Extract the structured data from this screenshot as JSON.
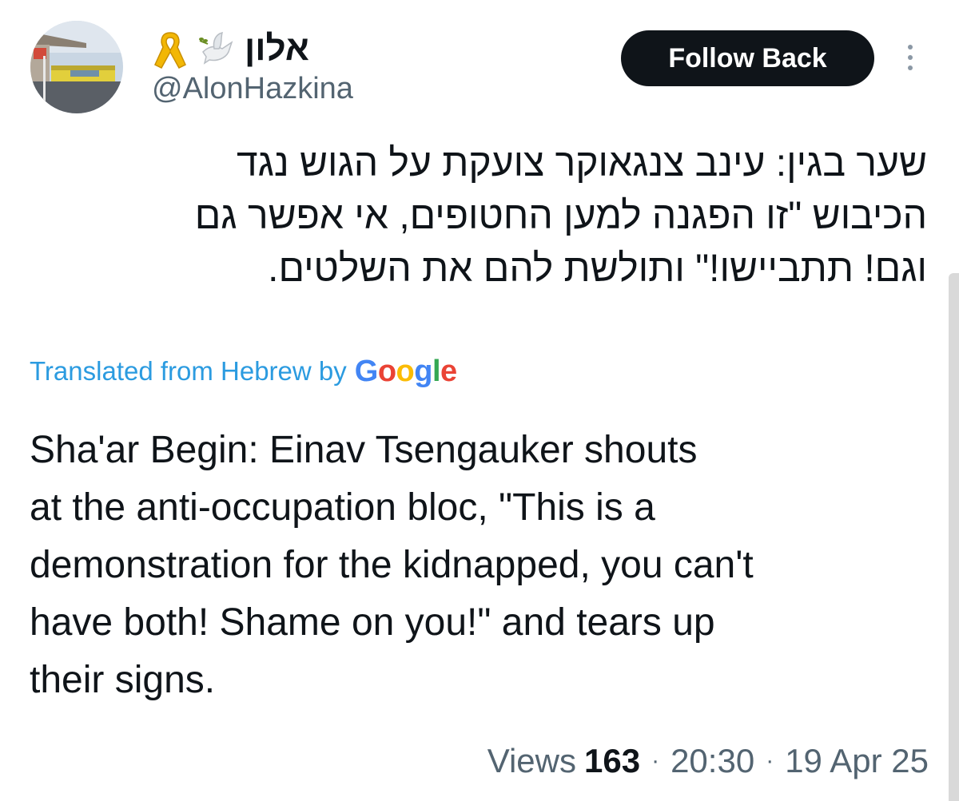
{
  "author": {
    "display_name": "אלון",
    "handle": "@AlonHazkina",
    "badges": [
      "yellow-ribbon-icon",
      "dove-icon"
    ]
  },
  "actions": {
    "follow_label": "Follow Back",
    "more_icon": "more-vertical-icon"
  },
  "tweet": {
    "original_text_lines": [
      "שער בגין: עינב צנגאוקר צועקת על הגוש נגד",
      "הכיבוש \"זו הפגנה למען החטופים, אי אפשר גם",
      "וגם! תתביישו!\" ותולשת להם את השלטים."
    ],
    "translation_label": "Translated from Hebrew by",
    "translation_provider": "Google",
    "translated_text_lines": [
      "Sha'ar Begin: Einav Tsengauker shouts",
      "at the anti-occupation bloc, \"This is a",
      "demonstration for the kidnapped, you can't",
      "have both! Shame on you!\" and tears up",
      "their signs."
    ]
  },
  "meta": {
    "views_label": "Views",
    "views_count": "163",
    "separator": "·",
    "time": "20:30",
    "date": "19 Apr 25"
  },
  "colors": {
    "accent": "#1d9bf0",
    "text_primary": "#0f1419",
    "text_secondary": "#536471",
    "button_bg": "#0f1419",
    "google_blue": "#4285F4",
    "google_red": "#EA4335",
    "google_yellow": "#FBBC05",
    "google_green": "#34A853"
  }
}
